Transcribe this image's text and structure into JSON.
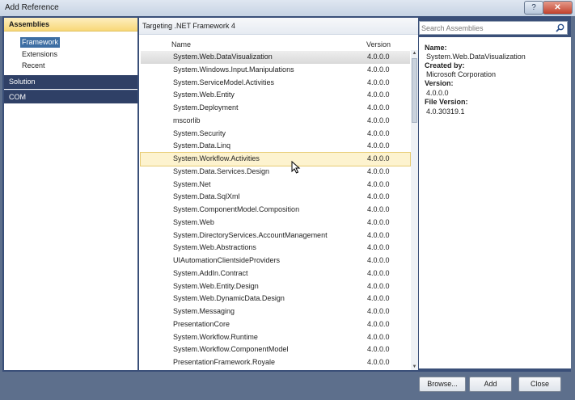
{
  "window": {
    "title": "Add Reference"
  },
  "nav": {
    "assemblies": "Assemblies",
    "framework": "Framework",
    "extensions": "Extensions",
    "recent": "Recent",
    "solution": "Solution",
    "com": "COM"
  },
  "center": {
    "targeting": "Targeting .NET Framework 4",
    "col_name": "Name",
    "col_version": "Version",
    "rows": [
      {
        "name": "System.Web.DataVisualization",
        "version": "4.0.0.0"
      },
      {
        "name": "System.Windows.Input.Manipulations",
        "version": "4.0.0.0"
      },
      {
        "name": "System.ServiceModel.Activities",
        "version": "4.0.0.0"
      },
      {
        "name": "System.Web.Entity",
        "version": "4.0.0.0"
      },
      {
        "name": "System.Deployment",
        "version": "4.0.0.0"
      },
      {
        "name": "mscorlib",
        "version": "4.0.0.0"
      },
      {
        "name": "System.Security",
        "version": "4.0.0.0"
      },
      {
        "name": "System.Data.Linq",
        "version": "4.0.0.0"
      },
      {
        "name": "System.Workflow.Activities",
        "version": "4.0.0.0"
      },
      {
        "name": "System.Data.Services.Design",
        "version": "4.0.0.0"
      },
      {
        "name": "System.Net",
        "version": "4.0.0.0"
      },
      {
        "name": "System.Data.SqlXml",
        "version": "4.0.0.0"
      },
      {
        "name": "System.ComponentModel.Composition",
        "version": "4.0.0.0"
      },
      {
        "name": "System.Web",
        "version": "4.0.0.0"
      },
      {
        "name": "System.DirectoryServices.AccountManagement",
        "version": "4.0.0.0"
      },
      {
        "name": "System.Web.Abstractions",
        "version": "4.0.0.0"
      },
      {
        "name": "UIAutomationClientsideProviders",
        "version": "4.0.0.0"
      },
      {
        "name": "System.AddIn.Contract",
        "version": "4.0.0.0"
      },
      {
        "name": "System.Web.Entity.Design",
        "version": "4.0.0.0"
      },
      {
        "name": "System.Web.DynamicData.Design",
        "version": "4.0.0.0"
      },
      {
        "name": "System.Messaging",
        "version": "4.0.0.0"
      },
      {
        "name": "PresentationCore",
        "version": "4.0.0.0"
      },
      {
        "name": "System.Workflow.Runtime",
        "version": "4.0.0.0"
      },
      {
        "name": "System.Workflow.ComponentModel",
        "version": "4.0.0.0"
      },
      {
        "name": "PresentationFramework.Royale",
        "version": "4.0.0.0"
      }
    ]
  },
  "search": {
    "placeholder": "Search Assemblies"
  },
  "details": {
    "name_label": "Name:",
    "name_value": "System.Web.DataVisualization",
    "created_label": "Created by:",
    "created_value": "Microsoft Corporation",
    "version_label": "Version:",
    "version_value": "4.0.0.0",
    "file_version_label": "File Version:",
    "file_version_value": "4.0.30319.1"
  },
  "buttons": {
    "browse": "Browse...",
    "add": "Add",
    "close": "Close"
  },
  "icons": {
    "search": "search-icon",
    "help": "help-icon",
    "close": "close-icon",
    "cursor": "mouse-cursor-icon"
  },
  "colors": {
    "selection": "#d9d9d9",
    "hover": "#fdf3cf",
    "nav_dark": "#2f4066",
    "nav_header": "#f8d878"
  }
}
